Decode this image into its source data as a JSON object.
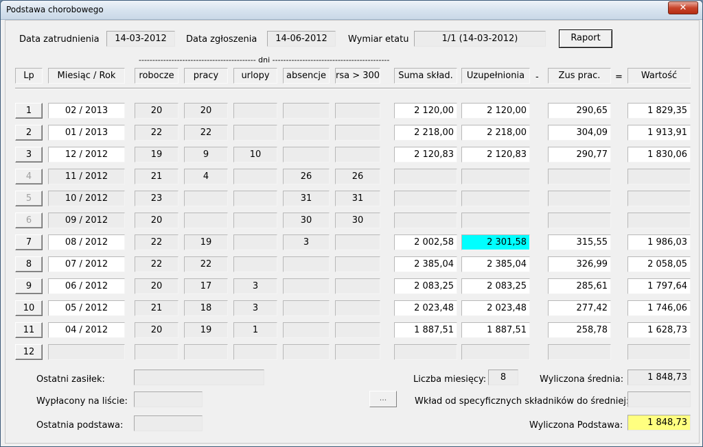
{
  "window": {
    "title": "Podstawa chorobowego",
    "close_glyph": "✕"
  },
  "header": {
    "data_zatrudnienia_label": "Data zatrudnienia",
    "data_zatrudnienia_value": "14-03-2012",
    "data_zgloszenia_label": "Data zgłoszenia",
    "data_zgloszenia_value": "14-06-2012",
    "wymiar_etatu_label": "Wymiar etatu",
    "wymiar_etatu_value": "1/1 (14-03-2012)",
    "raport_label": "Raport"
  },
  "dni_group_label": "------------------------------------------- dni -------------------------------------------",
  "columns": {
    "lp": "Lp",
    "miesiac": "Miesiąc / Rok",
    "robocze": "robocze",
    "pracy": "pracy",
    "urlopy": "urlopy",
    "absencje": "absencje",
    "rsa": "rsa > 300",
    "suma": "Suma skład.",
    "uzup": "Uzupełnionia",
    "minus": "-",
    "zus": "Zus prac.",
    "equals": "=",
    "wartosc": "Wartość"
  },
  "rows": [
    {
      "lp": "1",
      "month": "02 / 2013",
      "robocze": "20",
      "pracy": "20",
      "urlopy": "",
      "absencje": "",
      "rsa": "",
      "suma": "2 120,00",
      "uzup": "2 120,00",
      "zus": "290,65",
      "wartosc": "1 829,35",
      "enabled": true
    },
    {
      "lp": "2",
      "month": "01 / 2013",
      "robocze": "22",
      "pracy": "22",
      "urlopy": "",
      "absencje": "",
      "rsa": "",
      "suma": "2 218,00",
      "uzup": "2 218,00",
      "zus": "304,09",
      "wartosc": "1 913,91",
      "enabled": true
    },
    {
      "lp": "3",
      "month": "12 / 2012",
      "robocze": "19",
      "pracy": "9",
      "urlopy": "10",
      "absencje": "",
      "rsa": "",
      "suma": "2 120,83",
      "uzup": "2 120,83",
      "zus": "290,77",
      "wartosc": "1 830,06",
      "enabled": true
    },
    {
      "lp": "4",
      "month": "11 / 2012",
      "robocze": "21",
      "pracy": "4",
      "urlopy": "",
      "absencje": "26",
      "rsa": "26",
      "suma": "",
      "uzup": "",
      "zus": "",
      "wartosc": "",
      "enabled": false
    },
    {
      "lp": "5",
      "month": "10 / 2012",
      "robocze": "23",
      "pracy": "",
      "urlopy": "",
      "absencje": "31",
      "rsa": "31",
      "suma": "",
      "uzup": "",
      "zus": "",
      "wartosc": "",
      "enabled": false
    },
    {
      "lp": "6",
      "month": "09 / 2012",
      "robocze": "20",
      "pracy": "",
      "urlopy": "",
      "absencje": "30",
      "rsa": "30",
      "suma": "",
      "uzup": "",
      "zus": "",
      "wartosc": "",
      "enabled": false
    },
    {
      "lp": "7",
      "month": "08 / 2012",
      "robocze": "22",
      "pracy": "19",
      "urlopy": "",
      "absencje": "3",
      "rsa": "",
      "suma": "2 002,58",
      "uzup": "2 301,58",
      "zus": "315,55",
      "wartosc": "1 986,03",
      "enabled": true,
      "uzup_highlight": true
    },
    {
      "lp": "8",
      "month": "07 / 2012",
      "robocze": "22",
      "pracy": "22",
      "urlopy": "",
      "absencje": "",
      "rsa": "",
      "suma": "2 385,04",
      "uzup": "2 385,04",
      "zus": "326,99",
      "wartosc": "2 058,05",
      "enabled": true
    },
    {
      "lp": "9",
      "month": "06 / 2012",
      "robocze": "20",
      "pracy": "17",
      "urlopy": "3",
      "absencje": "",
      "rsa": "",
      "suma": "2 083,25",
      "uzup": "2 083,25",
      "zus": "285,61",
      "wartosc": "1 797,64",
      "enabled": true
    },
    {
      "lp": "10",
      "month": "05 / 2012",
      "robocze": "21",
      "pracy": "18",
      "urlopy": "3",
      "absencje": "",
      "rsa": "",
      "suma": "2 023,48",
      "uzup": "2 023,48",
      "zus": "277,42",
      "wartosc": "1 746,06",
      "enabled": true
    },
    {
      "lp": "11",
      "month": "04 / 2012",
      "robocze": "20",
      "pracy": "19",
      "urlopy": "1",
      "absencje": "",
      "rsa": "",
      "suma": "1 887,51",
      "uzup": "1 887,51",
      "zus": "258,78",
      "wartosc": "1 628,73",
      "enabled": true
    },
    {
      "lp": "12",
      "month": "",
      "robocze": "",
      "pracy": "",
      "urlopy": "",
      "absencje": "",
      "rsa": "",
      "suma": "",
      "uzup": "",
      "zus": "",
      "wartosc": "",
      "enabled": true,
      "empty": true
    }
  ],
  "footer": {
    "ostatni_zasilek_label": "Ostatni zasiłek:",
    "ostatni_zasilek_value": "",
    "wyplacony_label": "Wypłacony na liście:",
    "wyplacony_value": "",
    "ostatnia_podstawa_label": "Ostatnia podstawa:",
    "ostatnia_podstawa_value": "",
    "liczba_miesiecy_label": "Liczba miesięcy:",
    "liczba_miesiecy_value": "8",
    "wyliczona_srednia_label": "Wyliczona średnia:",
    "wyliczona_srednia_value": "1 848,73",
    "dots_label": "...",
    "wklad_label": "Wkład od specyficznych składników do średniej:",
    "wklad_value": "",
    "wyliczona_podstawa_label": "Wyliczona Podstawa:",
    "wyliczona_podstawa_value": "1 848,73"
  },
  "colors": {
    "highlight_cyan": "#00ffff",
    "highlight_yellow": "#ffff80"
  }
}
